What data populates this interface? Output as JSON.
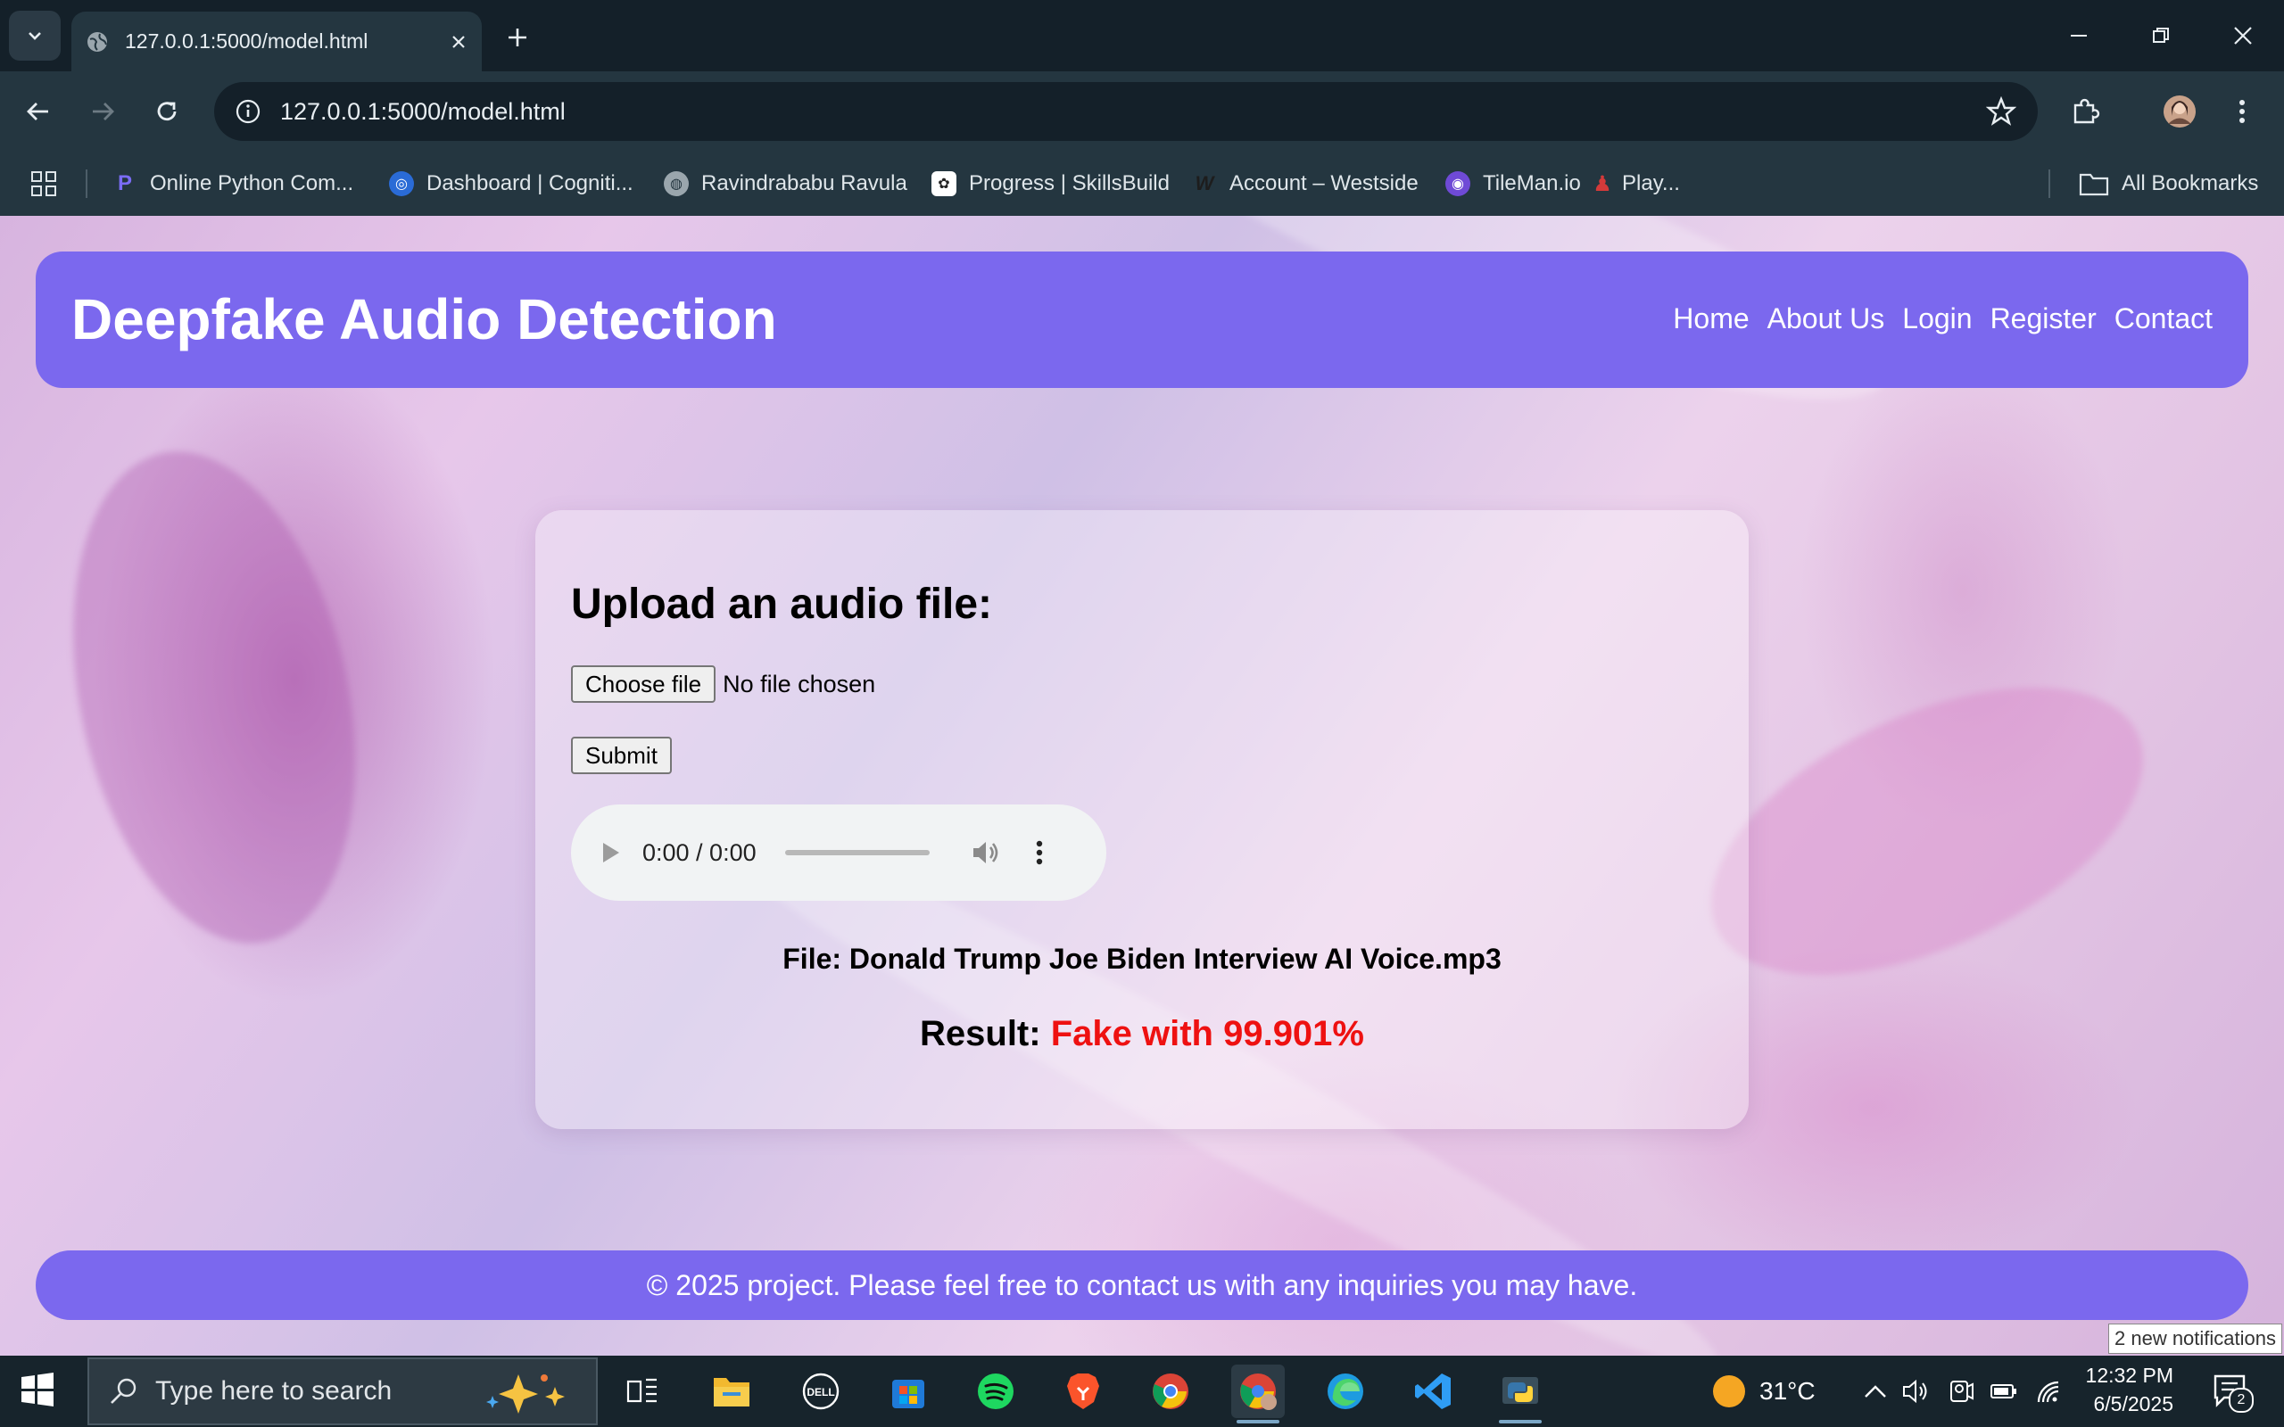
{
  "browser": {
    "tab_title": "127.0.0.1:5000/model.html",
    "url": "127.0.0.1:5000/model.html",
    "bookmarks": [
      {
        "label": "Online Python Com...",
        "icon": "python-icon"
      },
      {
        "label": "Dashboard | Cogniti...",
        "icon": "cognitive-icon"
      },
      {
        "label": "Ravindrababu Ravula",
        "icon": "globe-icon"
      },
      {
        "label": "Progress | SkillsBuild",
        "icon": "skillsbuild-icon"
      },
      {
        "label": "Account – Westside",
        "icon": "westside-icon"
      },
      {
        "label": "TileMan.io",
        "icon": "tileman-icon"
      },
      {
        "label": "Play...",
        "icon": "game-icon"
      }
    ],
    "all_bookmarks_label": "All Bookmarks"
  },
  "site": {
    "title": "Deepfake Audio Detection",
    "nav": [
      "Home",
      "About Us",
      "Login",
      "Register",
      "Contact"
    ],
    "upload_heading": "Upload an audio file:",
    "choose_file_label": "Choose file",
    "file_status": "No file chosen",
    "submit_label": "Submit",
    "audio_time": "0:00 / 0:00",
    "file_label": "File: Donald Trump Joe Biden Interview AI Voice.mp3",
    "result_label": "Result:",
    "result_value": "Fake with 99.901%",
    "footer": "© 2025 project. Please feel free to contact us with any inquiries you may have."
  },
  "taskbar": {
    "search_placeholder": "Type here to search",
    "weather": "31°C",
    "time": "12:32 PM",
    "date": "6/5/2025",
    "notification_toast": "2 new notifications",
    "notification_count": "2"
  },
  "colors": {
    "accent": "#7b68ee",
    "result_fake": "#ee1111",
    "chrome_bg": "#243640",
    "taskbar_bg": "#17242c"
  }
}
